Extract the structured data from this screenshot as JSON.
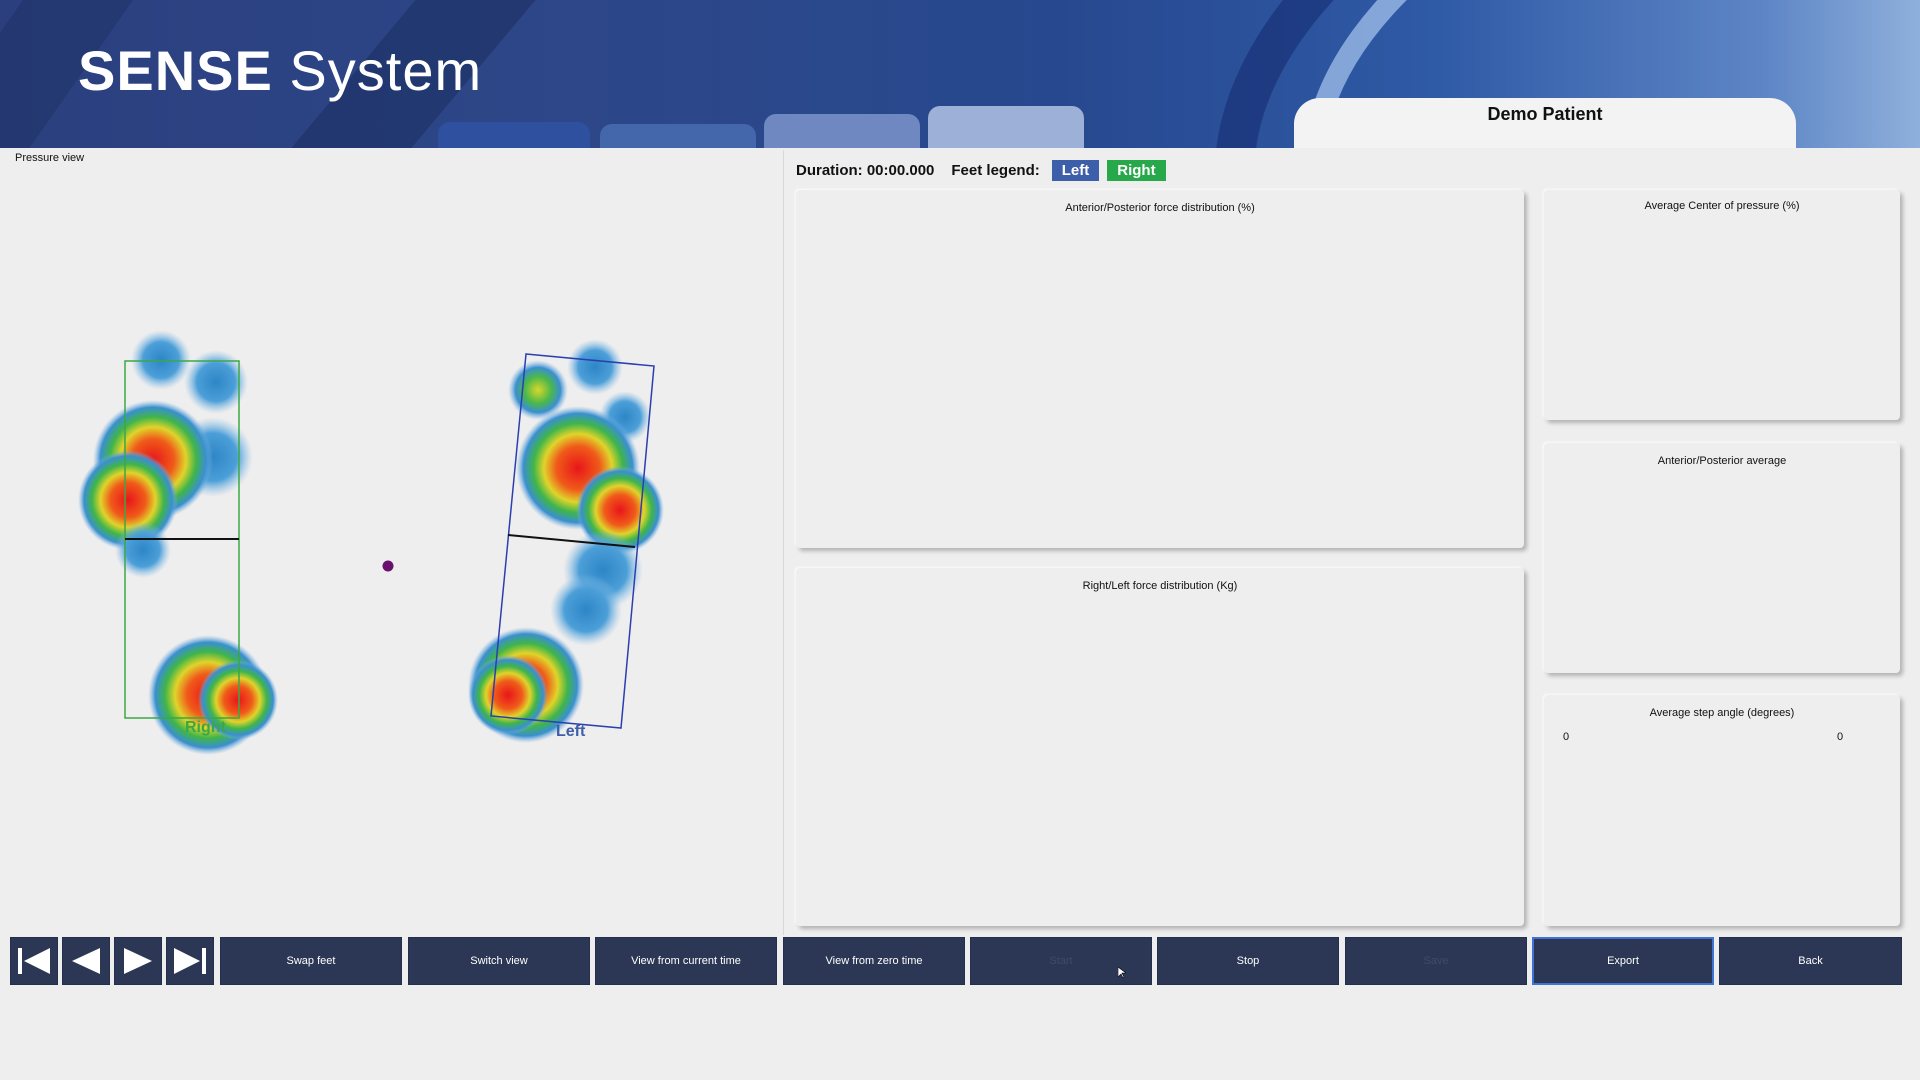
{
  "header": {
    "brand_bold": "SENSE",
    "brand_rest": "System",
    "patient": "Demo Patient"
  },
  "pressure_view": {
    "title": "Pressure view",
    "right_foot_label": "Right",
    "left_foot_label": "Left"
  },
  "legend": {
    "duration_label": "Duration: 00:00.000",
    "feet_legend_label": "Feet legend:",
    "left": "Left",
    "right": "Right",
    "left_color": "#3d5ea8",
    "right_color": "#27a84a"
  },
  "panels": {
    "ap_force": "Anterior/Posterior force distribution (%)",
    "rl_force": "Right/Left force distribution (Kg)",
    "avg_cop": "Average Center of pressure (%)",
    "ap_average": "Anterior/Posterior average",
    "step_angle": "Average step angle (degrees)",
    "step_angle_left_value": "0",
    "step_angle_right_value": "0"
  },
  "toolbar": {
    "first_icon": "skip-first-icon",
    "prev_icon": "step-back-icon",
    "play_icon": "play-icon",
    "last_icon": "skip-last-icon",
    "swap_feet": "Swap feet",
    "switch_view": "Switch view",
    "view_current": "View from current time",
    "view_zero": "View from zero time",
    "start": "Start",
    "stop": "Stop",
    "save": "Save",
    "export": "Export",
    "back": "Back"
  }
}
